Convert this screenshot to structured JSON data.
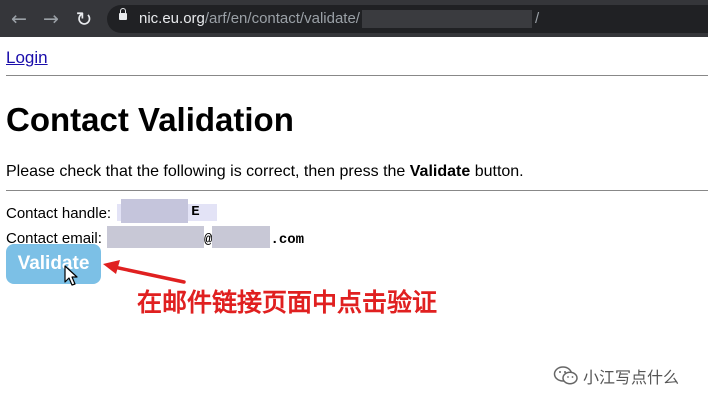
{
  "browser": {
    "url_host": "nic.eu.org",
    "url_path": "/arf/en/contact/validate/",
    "url_tail": "/"
  },
  "page": {
    "login_link": "Login",
    "title": "Contact Validation",
    "instruction_prefix": "Please check that the following is correct, then press the ",
    "instruction_bold": "Validate",
    "instruction_suffix": " button.",
    "handle_label": "Contact handle:",
    "handle_visible_suffix": "E",
    "email_label": "Contact email:",
    "email_at": "@",
    "email_suffix": ".com",
    "validate_button": "Validate"
  },
  "annotation": {
    "text": "在邮件链接页面中点击验证",
    "color": "#e02020"
  },
  "watermark": {
    "text": "小江写点什么",
    "icon": "wechat-icon"
  },
  "colors": {
    "button_bg": "#7cc0e6",
    "link": "#1a0dab",
    "toolbar": "#35363a"
  }
}
